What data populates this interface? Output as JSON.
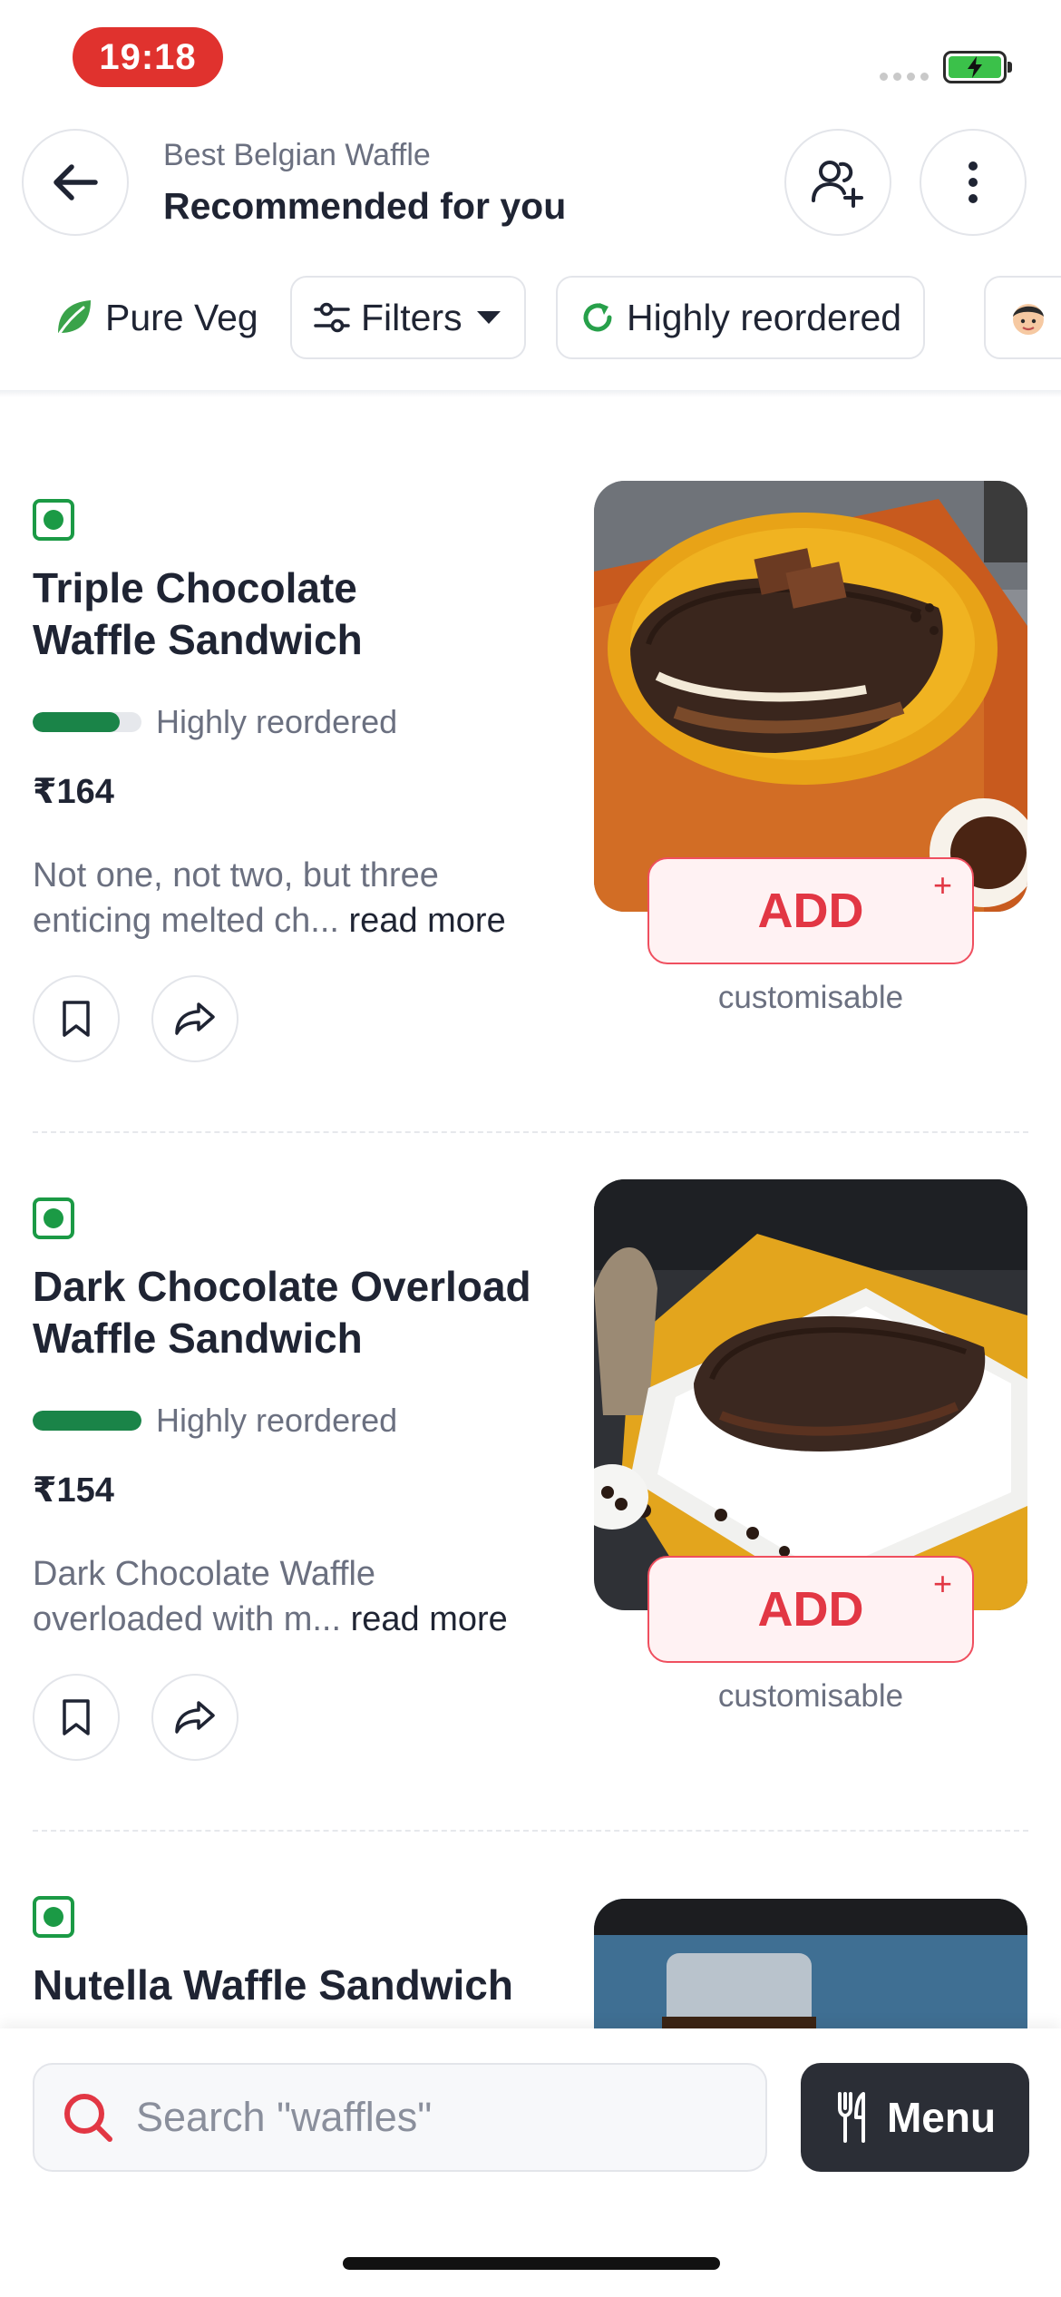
{
  "status_bar": {
    "time": "19:18"
  },
  "header": {
    "restaurant_name": "Best Belgian Waffle",
    "section_title": "Recommended for you"
  },
  "chips": [
    {
      "label": "Pure Veg"
    },
    {
      "label": "Filters"
    },
    {
      "label": "Highly reordered"
    },
    {
      "label": ""
    }
  ],
  "items": [
    {
      "name_line1": "Triple Chocolate",
      "name_line2": "Waffle Sandwich",
      "reorder_label": "Highly reordered",
      "reorder_level": 0.8,
      "price": "₹164",
      "desc_line1": "Not one, not two, but three",
      "desc_line2": "enticing melted ch...",
      "read_more": "read more",
      "add_label": "ADD",
      "add_plus": "+",
      "custom_label": "customisable"
    },
    {
      "name_line1": "Dark Chocolate Overload",
      "name_line2": "Waffle Sandwich",
      "reorder_label": "Highly reordered",
      "reorder_level": 1.0,
      "price": "₹154",
      "desc_line1": "Dark Chocolate Waffle",
      "desc_line2": "overloaded with m...",
      "read_more": "read more",
      "add_label": "ADD",
      "add_plus": "+",
      "custom_label": "customisable"
    },
    {
      "name_line1": "Nutella Waffle Sandwich"
    }
  ],
  "bottom_bar": {
    "search_placeholder": "Search \"waffles\"",
    "menu_label": "Menu"
  },
  "colors": {
    "veg_green": "#1b9a45",
    "reorder_bar": "#1a8448",
    "add_red": "#e23744",
    "status_red": "#e0322e"
  }
}
